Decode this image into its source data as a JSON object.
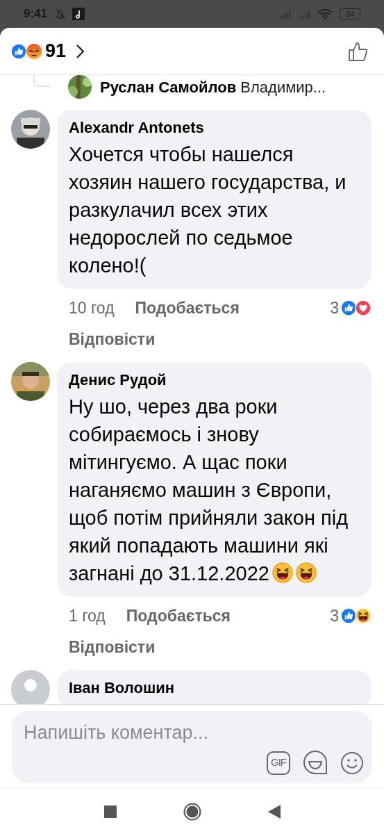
{
  "status_bar": {
    "time": "9:41",
    "battery": "24"
  },
  "header": {
    "reactions": [
      {
        "kind": "like"
      },
      {
        "kind": "angry"
      }
    ],
    "count": "91"
  },
  "reply_preview": {
    "author": "Руслан Самойлов",
    "text": "Владимир..."
  },
  "comments": [
    {
      "avatar": {
        "kind": "picture"
      },
      "author": "Alexandr  Antonets",
      "text": "Хочется чтобы нашелся хозяин нашего государства, и разкулачил всех этих недорослей по седьмое колено!(",
      "time": "10 год",
      "like": "Подобається",
      "reply": "Відповісти",
      "reaction_count": "3",
      "reactions": [
        {
          "kind": "like"
        },
        {
          "kind": "love"
        }
      ]
    },
    {
      "avatar": {
        "kind": "picture"
      },
      "author": "Денис Рудой",
      "text": "Ну шо, через два роки собираємось і знову мітингуємо. А щас поки наганяємо машин з Європи, щоб потім прийняли закон  під який попадають машини які загнані до 31.12.2022",
      "trailing_icons": [
        {
          "kind": "laugh"
        },
        {
          "kind": "laugh"
        }
      ],
      "time": "1 год",
      "like": "Подобається",
      "reply": "Відповісти",
      "reaction_count": "3",
      "reactions": [
        {
          "kind": "like"
        },
        {
          "kind": "haha"
        }
      ]
    },
    {
      "avatar": {
        "kind": "silhouette"
      },
      "author": "Іван Волошин"
    }
  ],
  "composer": {
    "placeholder": "Напишіть коментар...",
    "gif_label": "GIF"
  }
}
